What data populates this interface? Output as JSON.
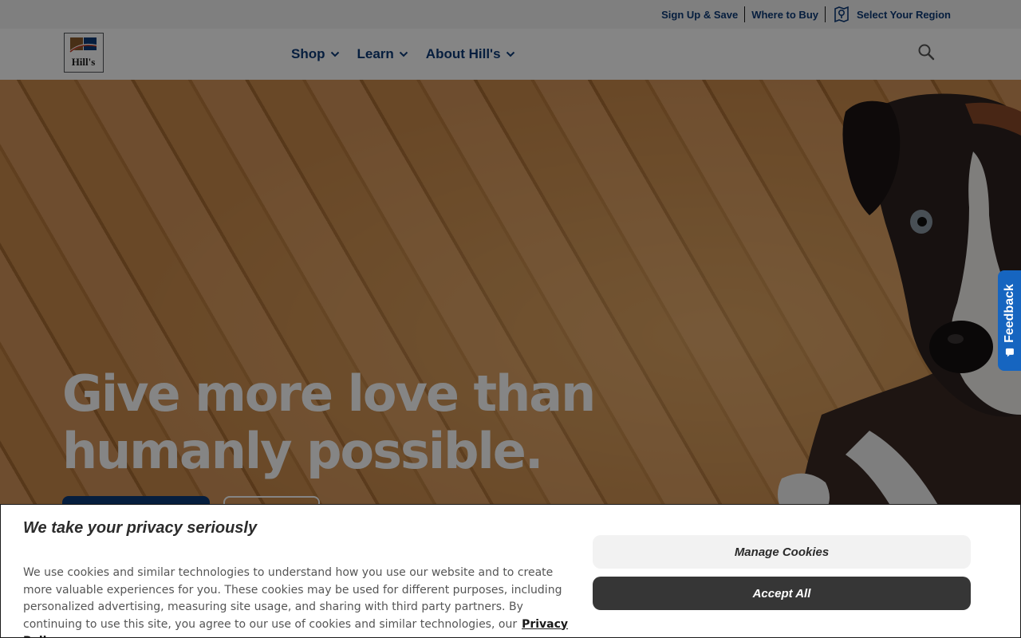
{
  "utility_bar": {
    "sign_up": "Sign Up & Save",
    "where_to_buy": "Where to Buy",
    "select_region": "Select Your Region"
  },
  "header": {
    "logo_text": "Hill's",
    "nav": [
      {
        "label": "Shop"
      },
      {
        "label": "Learn"
      },
      {
        "label": "About Hill's"
      }
    ]
  },
  "hero": {
    "headline": "Give more love than humanly possible."
  },
  "feedback": {
    "label": "Feedback"
  },
  "cookie_banner": {
    "title": "We take your privacy seriously",
    "body": "We use cookies and similar technologies to understand how you use our website and to create more valuable experiences for you. These cookies may be used for different purposes, including personalized advertising, measuring site usage, and sharing with third party partners. By continuing to use this site, you agree to our use of cookies and similar technologies, our",
    "privacy_link": "Privacy Policy.",
    "manage_button": "Manage Cookies",
    "accept_button": "Accept All"
  },
  "colors": {
    "brand_blue": "#0d3a78",
    "feedback_blue": "#1665c0",
    "accept_dark": "#363636"
  }
}
